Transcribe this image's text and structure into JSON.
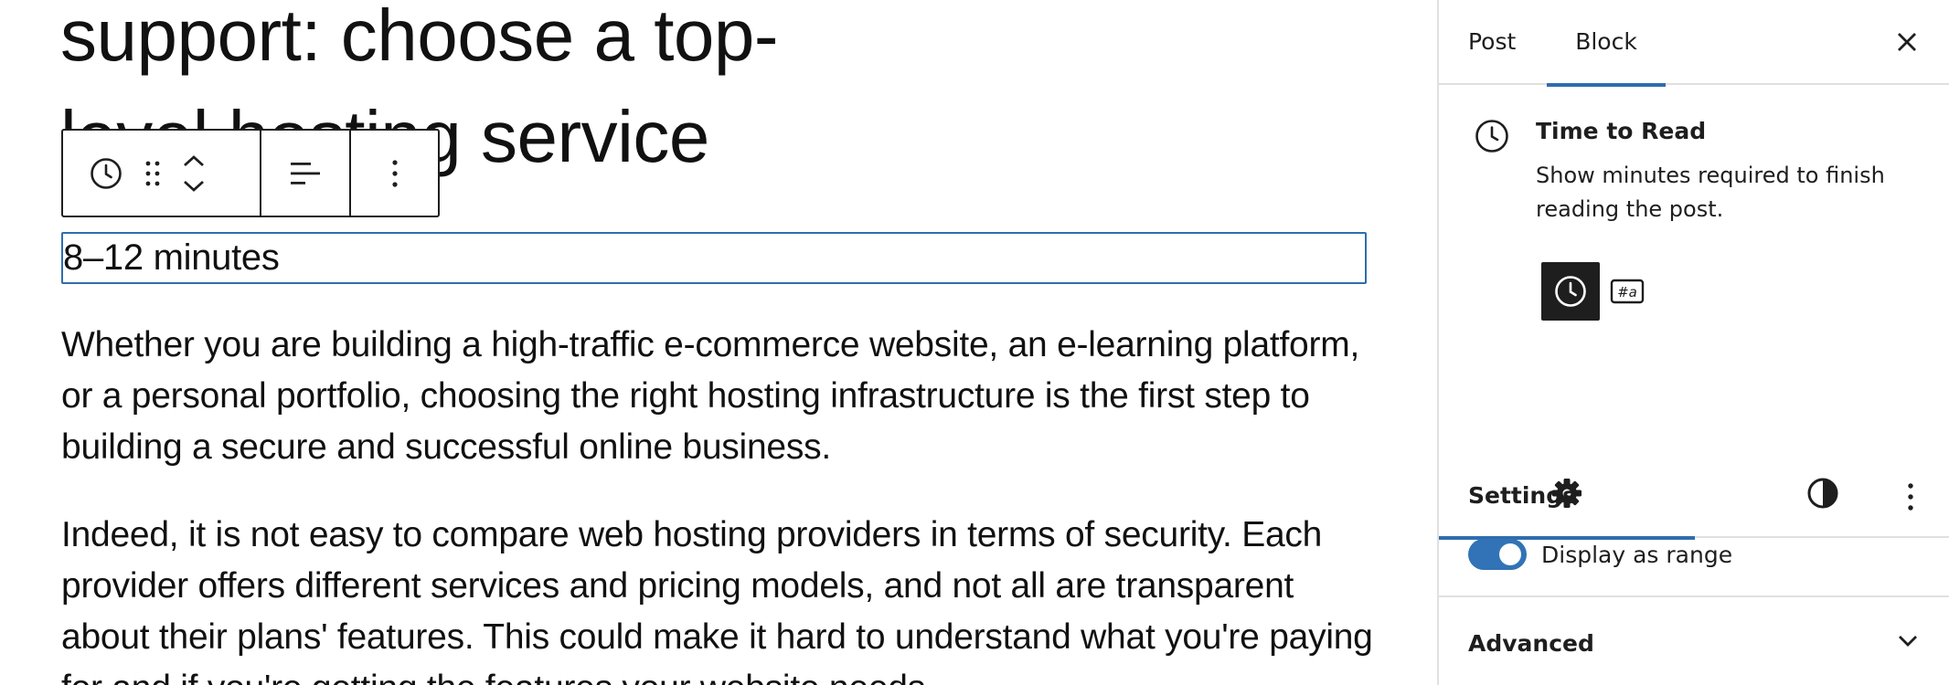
{
  "editor": {
    "post_title": "Security, performance and customer support: choose a top-\nlevel hosting service",
    "time_to_read_text": "8–12 minutes",
    "paragraphs": [
      "Whether you are building a high-traffic e-commerce website, an e-learning platform, or a personal portfolio, choosing the right hosting infrastructure is the first step to building a secure and successful online business.",
      "Indeed, it is not easy to compare web hosting providers in terms of security. Each provider offers different services and pricing models, and not all are transparent about their plans' features. This could make it hard to understand what you're paying for and if you're getting the features your website needs."
    ],
    "toolbar": {
      "block_icon": "clock-icon",
      "drag_icon": "drag-handle-icon",
      "move_up_icon": "chevron-up-icon",
      "move_down_icon": "chevron-down-icon",
      "align_icon": "align-left-icon",
      "options_icon": "more-vertical-icon"
    }
  },
  "sidebar": {
    "tabs": {
      "post": "Post",
      "block": "Block"
    },
    "active_tab": "Block",
    "close_icon": "close-icon",
    "block_card": {
      "icon": "clock-icon",
      "title": "Time to Read",
      "description": "Show minutes required to finish reading the post.",
      "variations": [
        {
          "icon": "clock-icon",
          "active": true
        },
        {
          "icon": "hash-a-icon",
          "text": "#a",
          "active": false
        }
      ]
    },
    "panel_tabs": [
      {
        "icon": "gear-icon",
        "active": true
      },
      {
        "icon": "contrast-icon",
        "active": false
      }
    ],
    "settings": {
      "title": "Settings",
      "toggle_label": "Display as range",
      "toggle_on": true
    },
    "advanced": {
      "title": "Advanced"
    }
  },
  "colors": {
    "accent": "#2f6dad",
    "toggle": "#3173b6",
    "text": "#1e1e1e",
    "border": "#e0e0e0"
  }
}
